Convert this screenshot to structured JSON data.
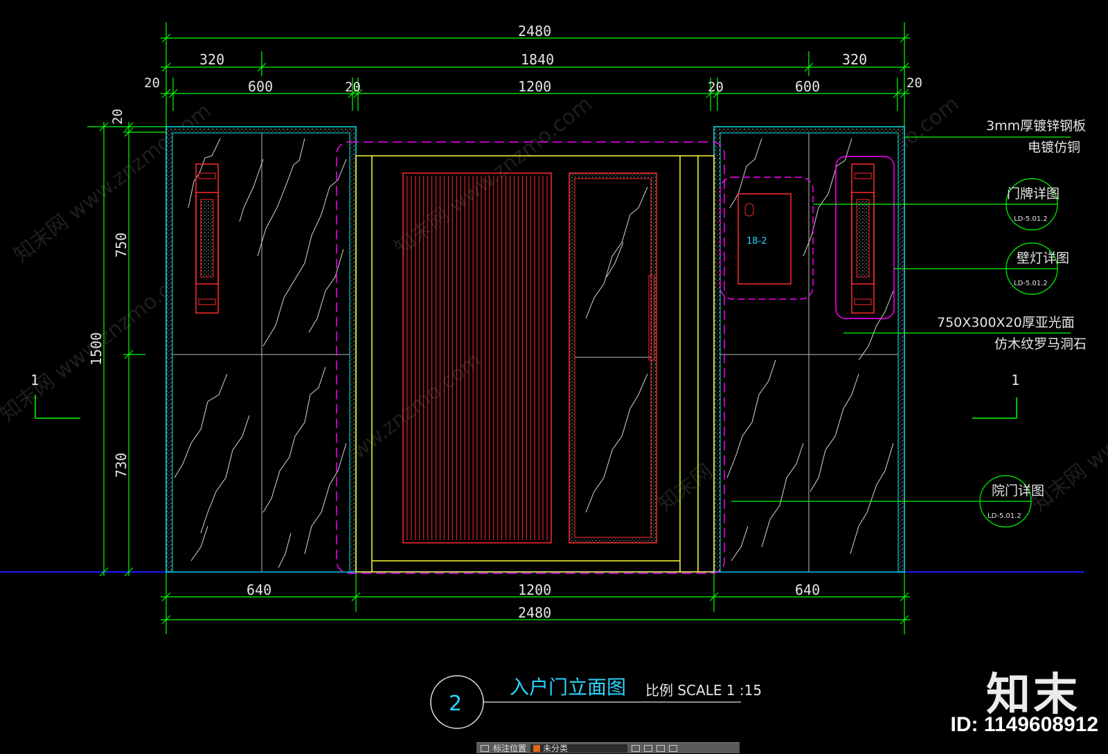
{
  "drawing": {
    "title": "入户门立面图",
    "number": "2",
    "scale": "比例 SCALE 1 :15"
  },
  "dimensions": {
    "top_total": "2480",
    "top_row2": [
      "320",
      "1840",
      "320"
    ],
    "top_row3": [
      "20",
      "600",
      "20",
      "1200",
      "20",
      "600",
      "20"
    ],
    "bottom_row1": [
      "640",
      "1200",
      "640"
    ],
    "bottom_total": "2480",
    "vertical_outer": "1500",
    "vertical_inner": [
      "20",
      "750",
      "730"
    ]
  },
  "annotations": {
    "galvanized_1": "3mm厚镀锌钢板",
    "galvanized_2": "电镀仿铜",
    "marble_1": "750X300X20厚亚光面",
    "marble_2": "仿木纹罗马洞石",
    "door_number": "18-2"
  },
  "detail_refs": [
    {
      "label": "门牌详图",
      "code": "LD-5.01.2"
    },
    {
      "label": "壁灯详图",
      "code": "LD-5.01.2"
    },
    {
      "label": "院门详图",
      "code": "LD-5.01.2"
    }
  ],
  "section_marks": [
    "1",
    "1"
  ],
  "watermark": {
    "text": "知末网 www.znzmo.com",
    "brand": "知末",
    "id": "ID: 1149608912"
  },
  "toolbar": {
    "layer_prefix": "标注位置",
    "layer_name": "未分类"
  },
  "colors": {
    "background": "#000000",
    "dimension": "#00ff00",
    "stone_edge": "#00e5e5",
    "door_red": "#ff2a2a",
    "door_frame": "#ffff33",
    "dashed_outline": "#ff00ff",
    "ground": "#1a1aff",
    "text_cyan": "#2ad4ff"
  }
}
